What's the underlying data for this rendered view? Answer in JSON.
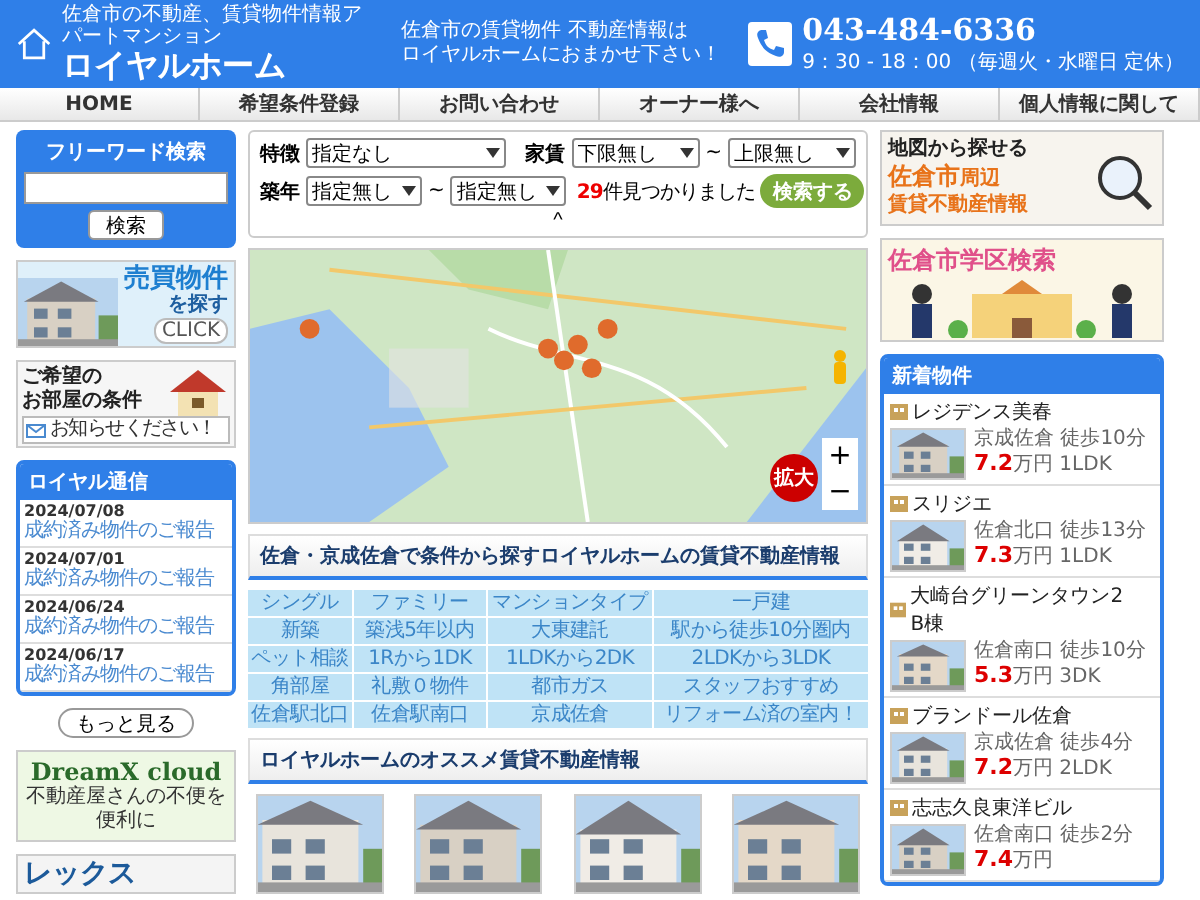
{
  "header": {
    "subtitle": "佐倉市の不動産、賃貸物件情報アパートマンション",
    "logo": "ロイヤルホーム",
    "tagline": [
      "佐倉市の賃貸物件 不動産情報は",
      "ロイヤルホームにおまかせ下さい！"
    ],
    "phone": "043-484-6336",
    "hours": "9：30 - 18：00 （毎週火・水曜日 定休）"
  },
  "nav": [
    "HOME",
    "希望条件登録",
    "お問い合わせ",
    "オーナー様へ",
    "会社情報",
    "個人情報に関して"
  ],
  "left": {
    "search": {
      "title": "フリーワード検索",
      "button": "検索"
    },
    "banner_sale": {
      "title": "売買物件",
      "sub": "を探す",
      "click": "CLICK"
    },
    "banner_request": {
      "line1": "ご希望の",
      "line2": "お部屋の条件",
      "note": "お知らせください！"
    },
    "news": {
      "title": "ロイヤル通信",
      "items": [
        {
          "date": "2024/07/08",
          "text": "成約済み物件のご報告"
        },
        {
          "date": "2024/07/01",
          "text": "成約済み物件のご報告"
        },
        {
          "date": "2024/06/24",
          "text": "成約済み物件のご報告"
        },
        {
          "date": "2024/06/17",
          "text": "成約済み物件のご報告"
        }
      ],
      "more": "もっと見る"
    },
    "banner_dreamx": {
      "title": "DreamX cloud",
      "sub": "不動産屋さんの不便を便利に"
    },
    "banner_rex": {
      "title": "レックス"
    }
  },
  "filter": {
    "feature_label": "特徴",
    "feature": "指定なし",
    "rent_label": "家賃",
    "rent_min": "下限無し",
    "rent_sep": "~",
    "rent_max": "上限無し",
    "age_label": "築年",
    "age_min": "指定無し",
    "age_sep": "~",
    "age_max": "指定無し",
    "count": "29",
    "count_text": "件見つかりました",
    "button": "検索する",
    "collapse": "^"
  },
  "map": {
    "zoom_in": "+",
    "zoom_out": "−",
    "enlarge": "拡大"
  },
  "conditions": {
    "title": "佐倉・京成佐倉で条件から探すロイヤルホームの賃貸不動産情報",
    "rows": [
      [
        "シングル",
        "ファミリー",
        "マンションタイプ",
        "一戸建"
      ],
      [
        "新築",
        "築浅5年以内",
        "大東建託",
        "駅から徒歩10分圏内"
      ],
      [
        "ペット相談",
        "1Rから1DK",
        "1LDKから2DK",
        "2LDKから3LDK"
      ],
      [
        "角部屋",
        "礼敷０物件",
        "都市ガス",
        "スタッフおすすめ"
      ],
      [
        "佐倉駅北口",
        "佐倉駅南口",
        "京成佐倉",
        "リフォーム済の室内！"
      ]
    ]
  },
  "recommend": {
    "title": "ロイヤルホームのオススメ賃貸不動産情報"
  },
  "right": {
    "banner_map": {
      "line1": "地図から探せる",
      "line2": "佐倉市",
      "line2b": "周辺",
      "line3": "賃貸不動産情報"
    },
    "banner_school": {
      "title": "佐倉市学区検索"
    },
    "new_listings": {
      "title": "新着物件",
      "items": [
        {
          "name": "レジデンス美春",
          "station": "京成佐倉",
          "walk": "徒歩10分",
          "price": "7.2",
          "unit": "万円",
          "layout": "1LDK"
        },
        {
          "name": "スリジエ",
          "station": "佐倉北口",
          "walk": "徒歩13分",
          "price": "7.3",
          "unit": "万円",
          "layout": "1LDK"
        },
        {
          "name": "大崎台グリーンタウン2　B棟",
          "station": "佐倉南口",
          "walk": "徒歩10分",
          "price": "5.3",
          "unit": "万円",
          "layout": "3DK"
        },
        {
          "name": "ブランドール佐倉",
          "station": "京成佐倉",
          "walk": "徒歩4分",
          "price": "7.2",
          "unit": "万円",
          "layout": "2LDK"
        },
        {
          "name": "志志久良東洋ビル",
          "station": "佐倉南口",
          "walk": "徒歩2分",
          "price": "7.4",
          "unit": "万円"
        }
      ]
    }
  }
}
